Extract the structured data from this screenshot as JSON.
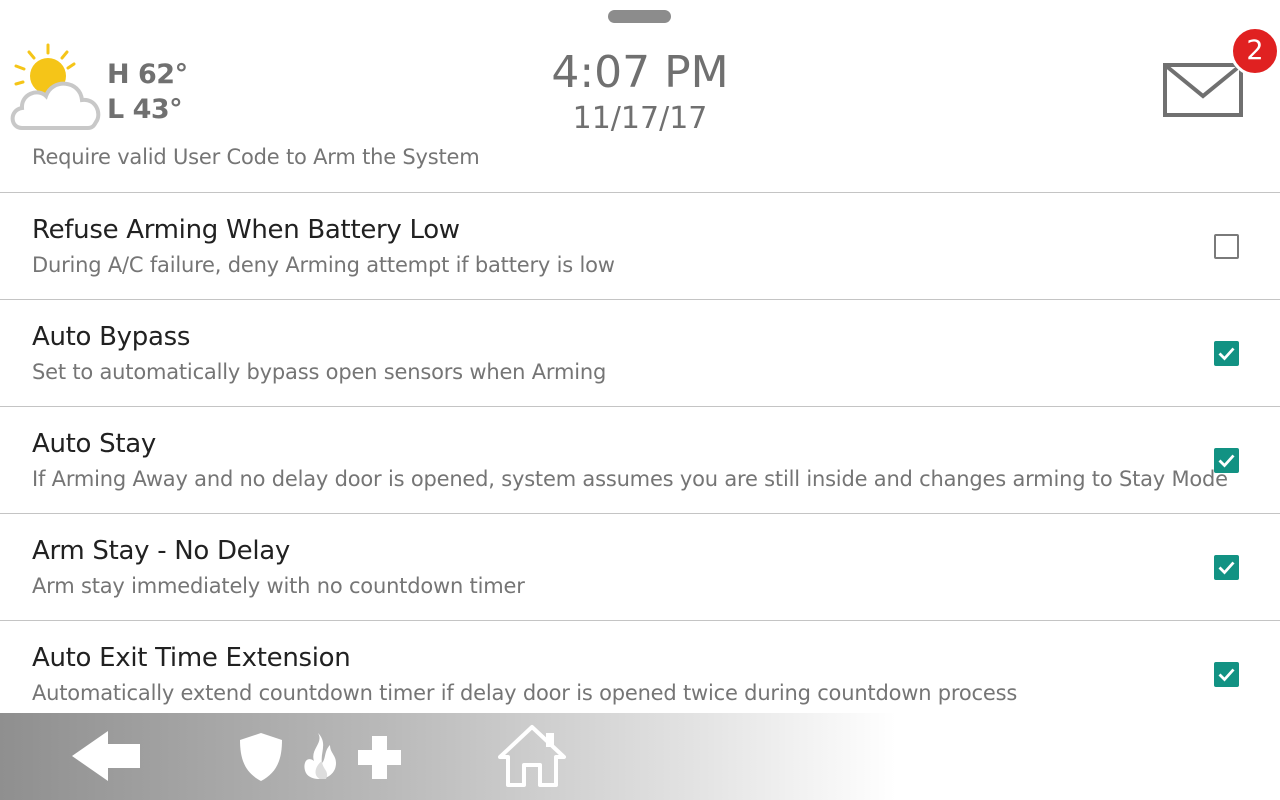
{
  "header": {
    "weather": {
      "icon": "partly-cloudy-icon",
      "high": "H 62°",
      "low": "L 43°"
    },
    "time": "4:07 PM",
    "date": "11/17/17",
    "messages": {
      "icon": "envelope-icon",
      "unread_count": "2",
      "badge_color": "#e02121"
    }
  },
  "settings": {
    "partial_item_description": "Require valid User Code to Arm the System",
    "items": [
      {
        "title": "Refuse Arming When Battery Low",
        "description": "During A/C failure, deny Arming attempt if battery is low",
        "checked": false
      },
      {
        "title": "Auto Bypass",
        "description": "Set to automatically bypass open sensors when Arming",
        "checked": true
      },
      {
        "title": "Auto Stay",
        "description": "If Arming Away and no delay door is opened, system assumes you are still inside and changes arming to Stay Mode",
        "checked": true
      },
      {
        "title": "Arm Stay - No Delay",
        "description": "Arm stay immediately with no countdown timer",
        "checked": true
      },
      {
        "title": "Auto Exit Time Extension",
        "description": "Automatically extend countdown timer if delay door is opened twice during countdown process",
        "checked": true
      }
    ],
    "checkbox_color": "#129283"
  },
  "navbar": {
    "icons": [
      "back-arrow-icon",
      "shield-icon",
      "fire-icon",
      "medical-cross-icon",
      "home-icon"
    ]
  }
}
